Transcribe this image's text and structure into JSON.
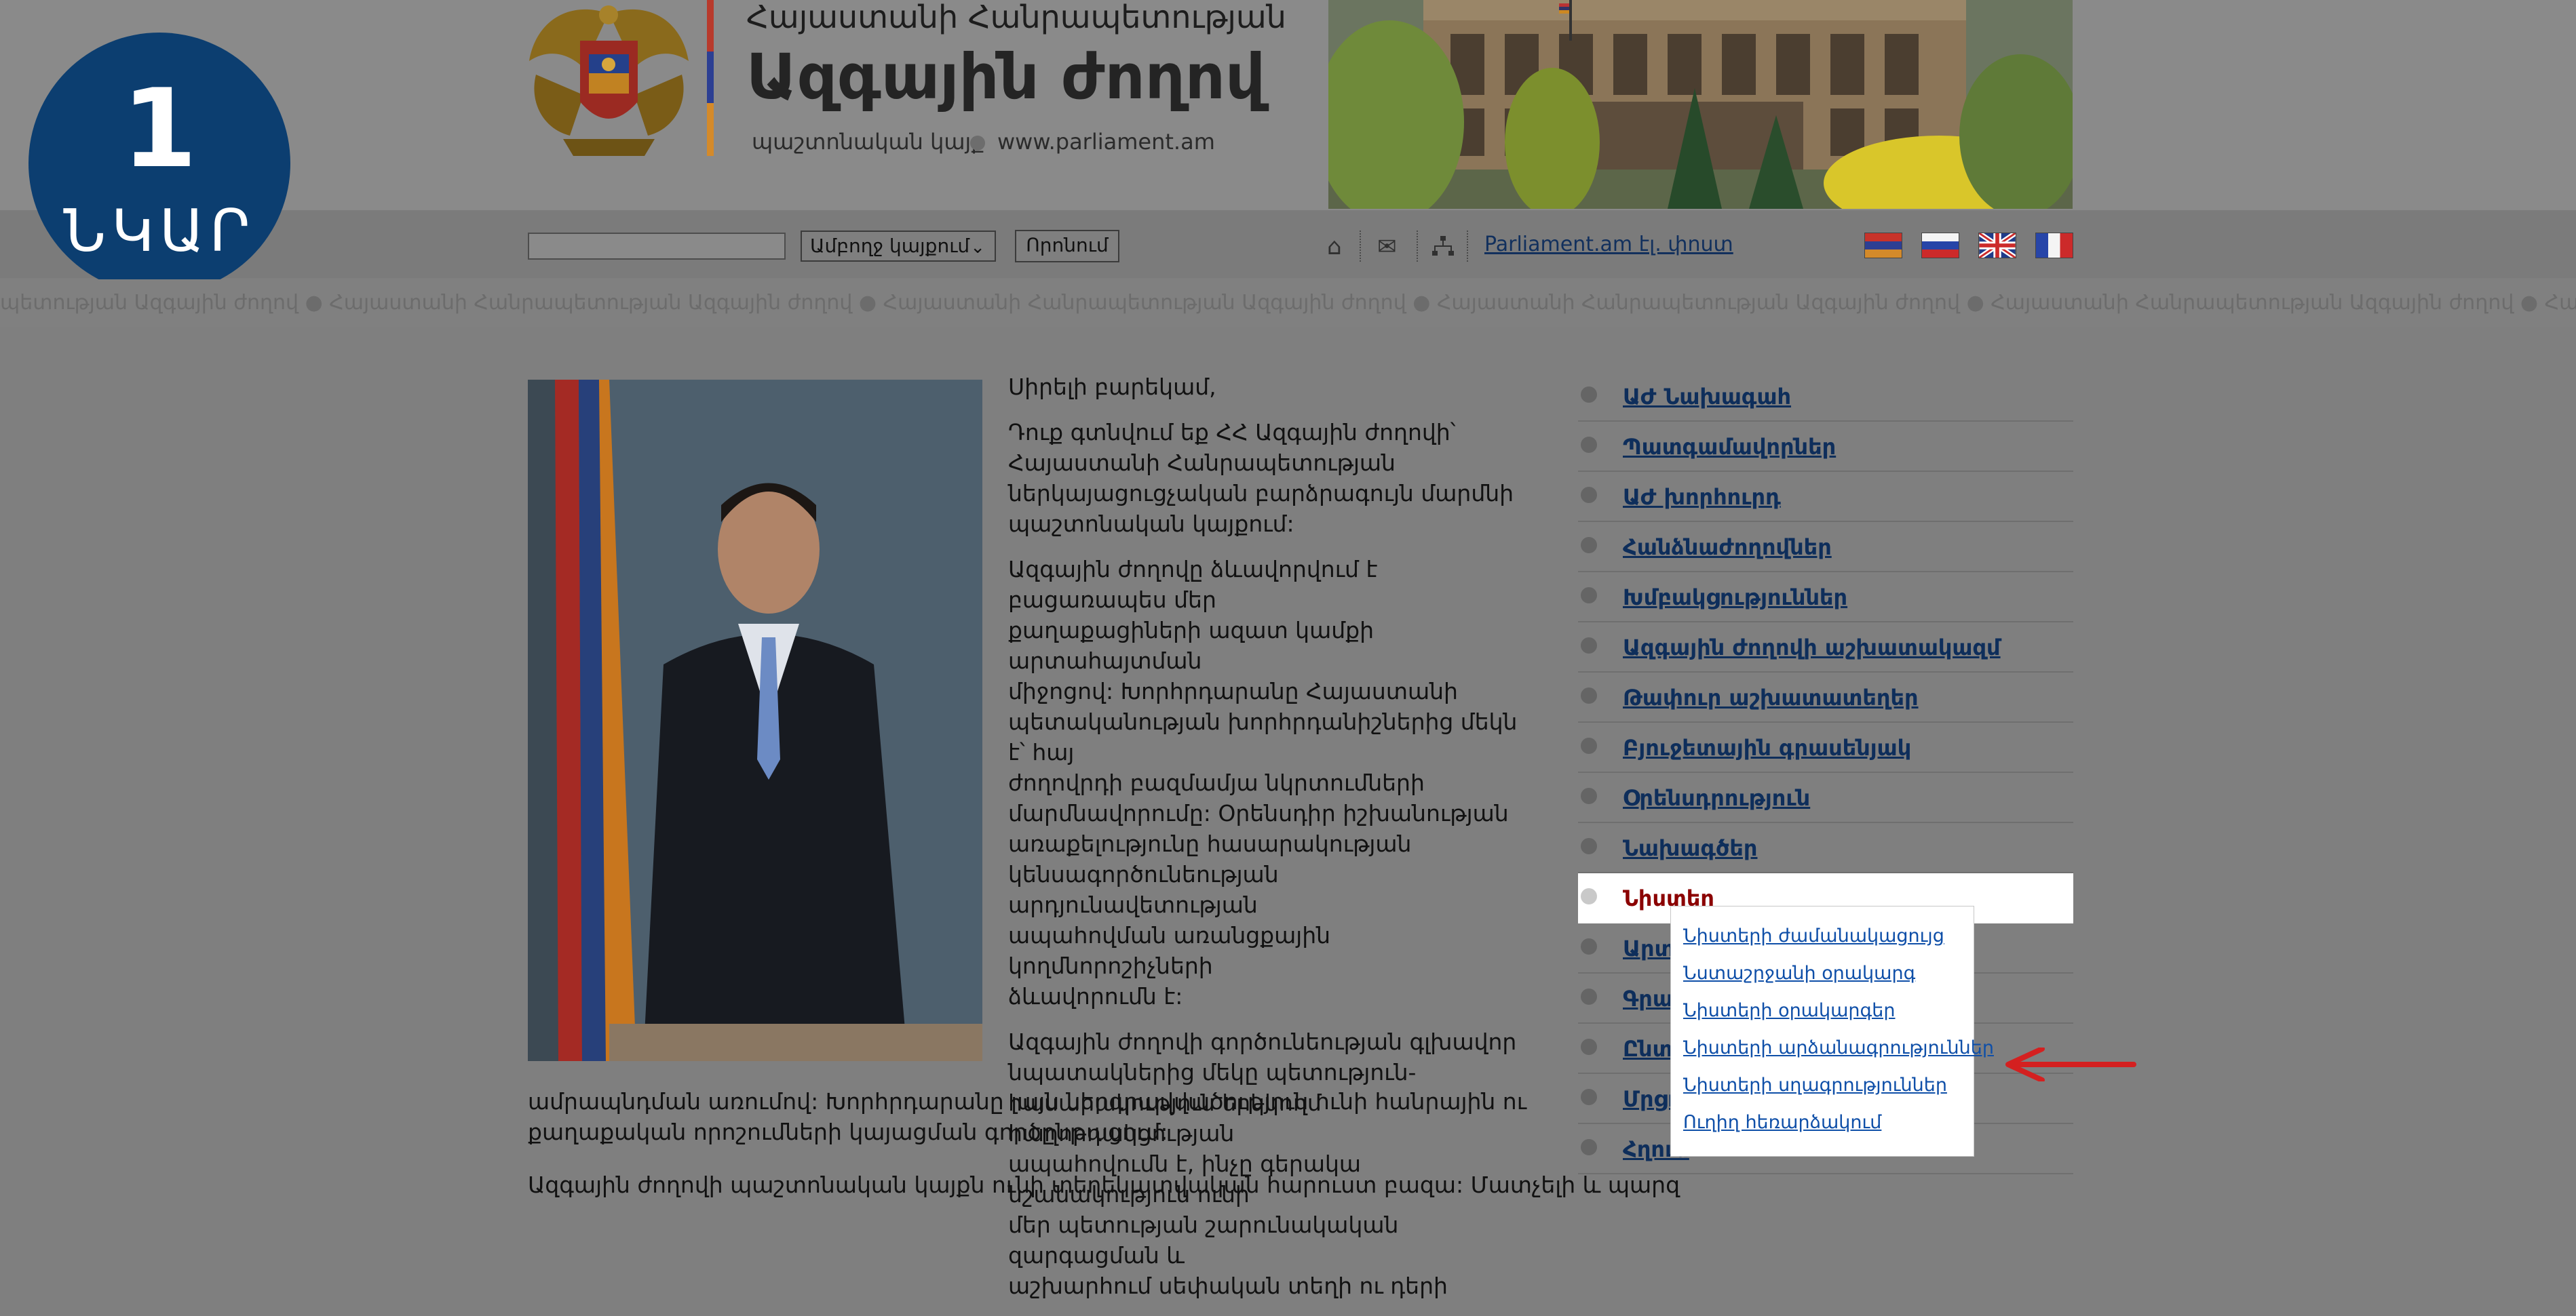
{
  "badge": {
    "number": "1",
    "word": "ՆԿԱՐ"
  },
  "header": {
    "supertitle": "Հայաստանի Հանրապետության",
    "title": "Ազգային ժողով",
    "subtitle": "պաշտոնական կայք",
    "site_url": "www.parliament.am"
  },
  "toolbar": {
    "search_value": "",
    "select_value": "Ամբողջ կայքում",
    "search_button": "Որոնում",
    "simple_version_link": "Parliament.am էլ. փոստ",
    "icons": [
      "home-icon",
      "mail-icon",
      "sitemap-icon"
    ],
    "languages": [
      "Armenian",
      "Russian",
      "English",
      "French"
    ]
  },
  "marquee": "պետության Ազգային ժողով ● Հայաստանի Հանրապետության Ազգային ժողով ● Հայաստանի Հանրապետության Ազգային ժողով ● Հայաստանի Հանրապետության Ազգային ժողով ● Հայաստանի Հանրապետության Ազգային ժողով ● Հայաստանի Հանրապետության Ազգային ժողով ● Հայաստանի Հանրապետության Ազգային ժողով ● Հայաստանի",
  "content": {
    "greeting": "Սիրելի բարեկամ,",
    "para1": [
      "Դուք գտնվում եք ՀՀ Ազգային ժողովի՝",
      "Հայաստանի Հանրապետության",
      "ներկայացուցչական բարձրագույն մարմնի",
      "պաշտոնական կայքում:"
    ],
    "para2": [
      "Ազգային ժողովը ձևավորվում է բացառապես մեր",
      "քաղաքացիների ազատ կամքի արտահայտման",
      "միջոցով: Խորհրդարանը Հայաստանի",
      "պետականության խորհրդանիշներից մեկն է՝ հայ",
      "ժողովրդի բազմամյա նկրտումների",
      "մարմնավորումը: Օրենսդիր իշխանության",
      "առաքելությունը հասարակության",
      "կենսագործունեության արդյունավետության",
      "ապահովման առանցքային կողմնորոշիչների",
      "ձևավորումն է:"
    ],
    "para3": [
      "Ազգային ժողովի գործունեության գլխավոր",
      "նպատակներից մեկը պետություն-",
      "հասարակություն երկկողմ հաղորդակցության",
      "ապահովումն է, ինչը գերակա նշանակություն ունի",
      "մեր պետության շարունակական զարգացման և",
      "աշխարհում սեփական տեղի ու դերի"
    ],
    "para3_wide": [
      "ամրապնդման առումով: Խորհրդարանը լայն ներգրավվածություն ունի հանրային ու",
      "քաղաքական որոշումների կայացման գործընթացում:"
    ],
    "para4_wide": "Ազգային ժողովի պաշտոնական կայքն ունի տեղեկատվական հարուստ բազա: Մատչելի և պարզ"
  },
  "menu": [
    {
      "label": "ԱԺ Նախագահ",
      "active": false
    },
    {
      "label": "Պատգամավորներ",
      "active": false
    },
    {
      "label": "ԱԺ խորհուրդ",
      "active": false
    },
    {
      "label": "Հանձնաժողովներ",
      "active": false
    },
    {
      "label": "Խմբակցություններ",
      "active": false
    },
    {
      "label": "Ազգային ժողովի աշխատակազմ",
      "active": false
    },
    {
      "label": "Թափուր աշխատատեղեր",
      "active": false
    },
    {
      "label": "Բյուջետային գրասենյակ",
      "active": false
    },
    {
      "label": "Օրենսդրություն",
      "active": false
    },
    {
      "label": "Նախագծեր",
      "active": false
    },
    {
      "label": "Նիստեր",
      "active": true
    },
    {
      "label": "Արտ",
      "active": false
    },
    {
      "label": "Գրա",
      "active": false
    },
    {
      "label": "Ընտ",
      "active": false
    },
    {
      "label": "Մրցո",
      "active": false
    },
    {
      "label": "Հղում",
      "active": false
    }
  ],
  "submenu": [
    "Նիստերի ժամանակացույց",
    "Նստաշրջանի օրակարգ",
    "Նիստերի օրակարգեր",
    "Նիստերի արձանագրություններ",
    "Նիստերի սղագրություններ",
    "Ուղիղ հեռարձակում"
  ],
  "colors": {
    "badge": "#0c3e70",
    "menu_link": "#0e2e5b",
    "menu_active": "#8b0000",
    "submenu_link": "#0f4fa8",
    "arrow": "#d42020"
  }
}
